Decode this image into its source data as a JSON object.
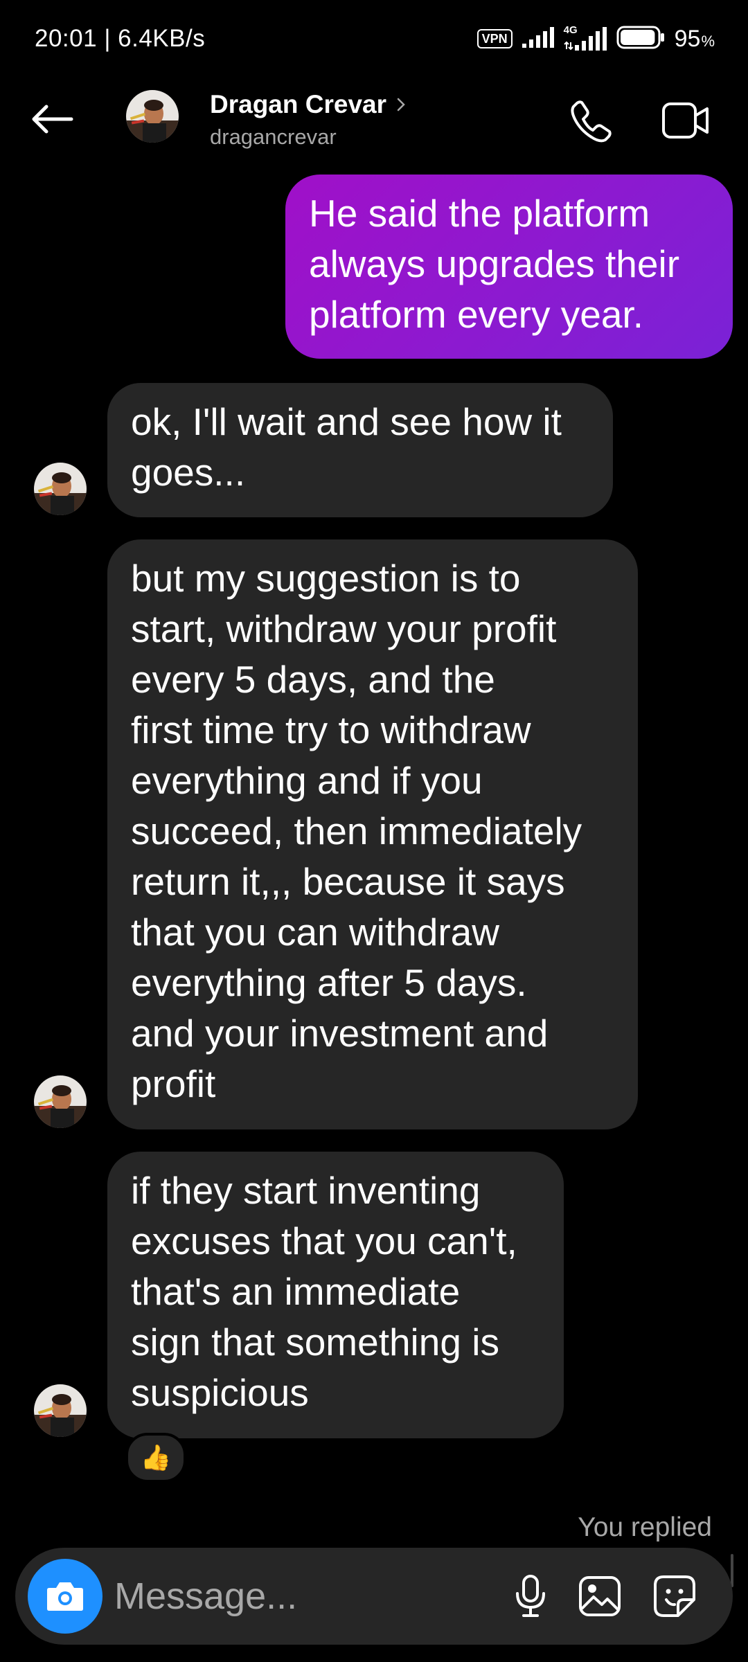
{
  "status_bar": {
    "time": "20:01",
    "separator": " | ",
    "network_speed": "6.4KB/s",
    "vpn_label": "VPN",
    "network_type": "4G",
    "battery_percent": "95",
    "battery_percent_sign": "%",
    "battery_level": 0.95,
    "icons": [
      "vpn-badge",
      "signal-icon",
      "signal-4g-icon",
      "battery-icon"
    ]
  },
  "header": {
    "contact_name": "Dragan Crevar",
    "contact_handle": "dragancrevar",
    "icons": [
      "back-arrow-icon",
      "avatar",
      "chevron-right-icon",
      "phone-icon",
      "video-camera-icon"
    ]
  },
  "messages": [
    {
      "direction": "sent",
      "lines": [
        "He said the platform",
        "always upgrades their",
        "platform every year."
      ]
    },
    {
      "direction": "received",
      "lines": [
        "ok, I'll wait and see how it",
        "goes..."
      ]
    },
    {
      "direction": "received",
      "lines": [
        "but my suggestion is to",
        "start, withdraw your profit",
        "every 5 days, and the",
        "first time try to withdraw",
        "everything and if you",
        "succeed, then immediately",
        "return it,,, because it says",
        "that you can withdraw",
        "everything after 5 days.",
        "and your investment and",
        "profit"
      ]
    },
    {
      "direction": "received",
      "lines": [
        "if they start inventing",
        "excuses that you can't,",
        "that's an immediate",
        "sign that something is",
        "suspicious"
      ],
      "reaction": "👍"
    }
  ],
  "you_replied": "You replied",
  "composer": {
    "placeholder": "Message...",
    "icons": [
      "camera-icon",
      "microphone-icon",
      "image-icon",
      "sticker-icon"
    ]
  },
  "colors": {
    "background": "#000000",
    "received_bubble": "#262626",
    "sent_bubble_start": "#a010c8",
    "sent_bubble_end": "#7a22d6",
    "secondary_text": "#a8a8a8",
    "camera_button": "#1e90ff"
  }
}
